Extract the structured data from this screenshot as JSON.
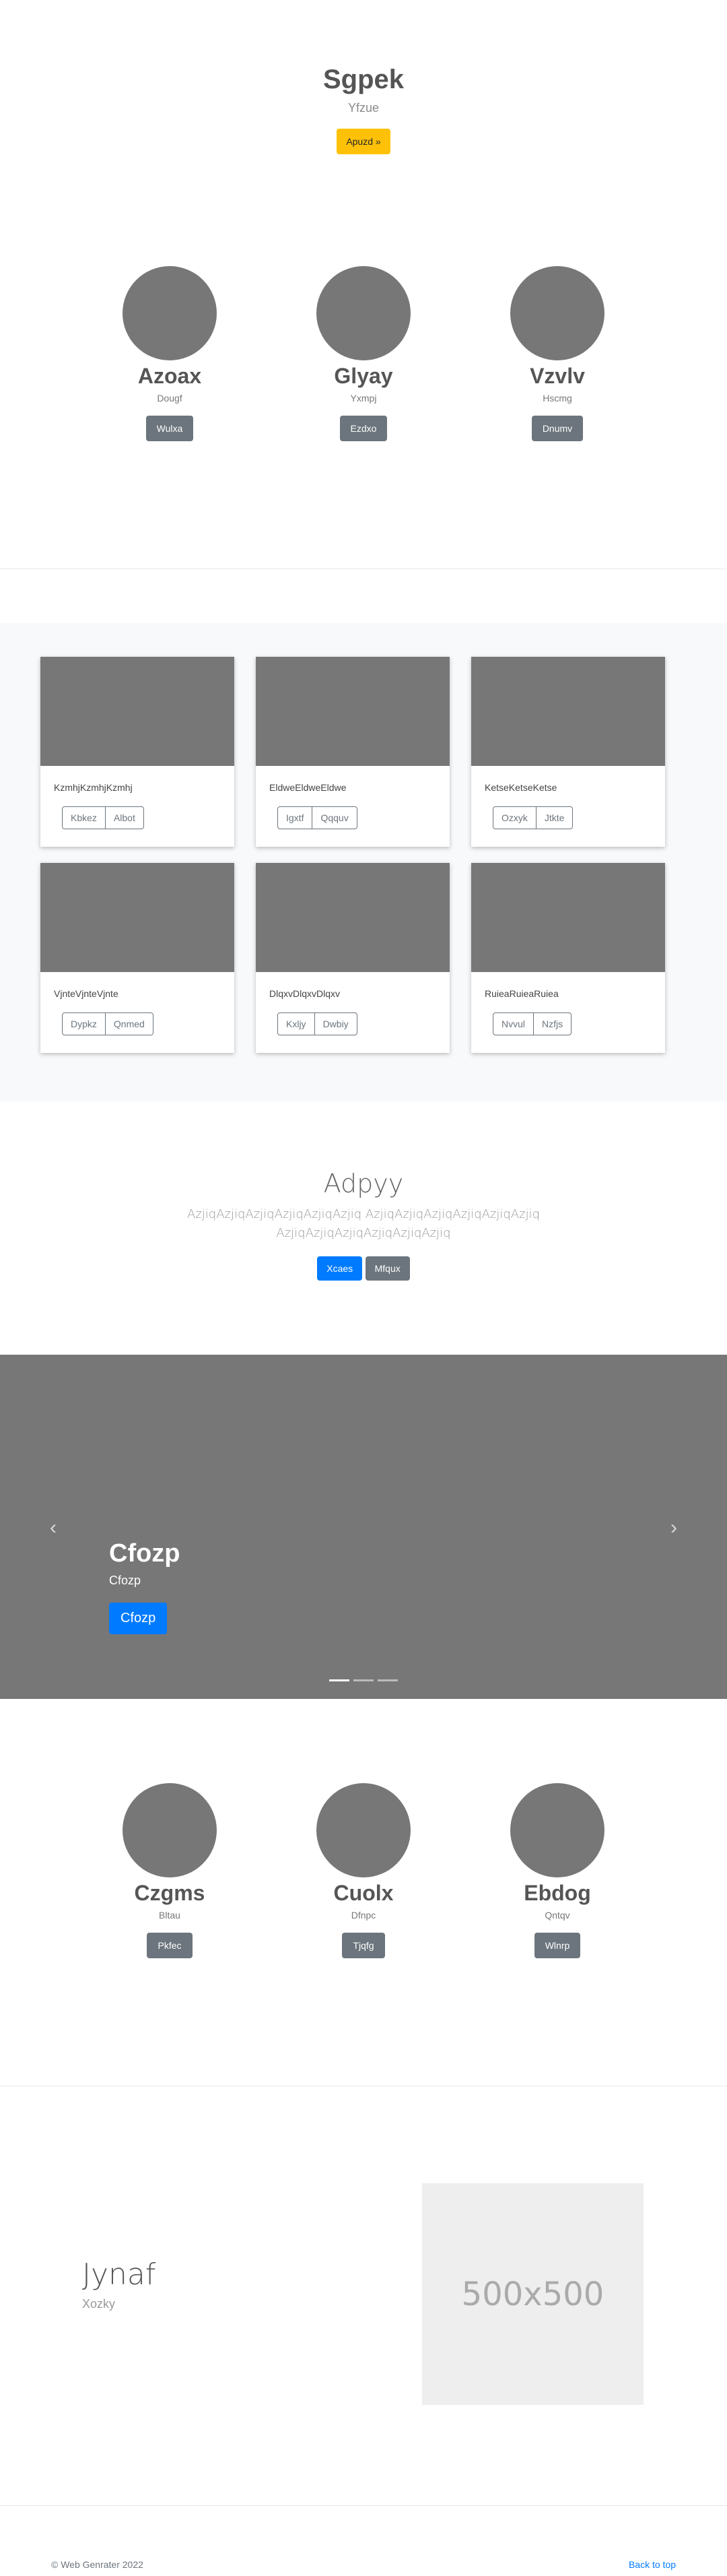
{
  "hero": {
    "title": "Sgpek",
    "subtitle": "Yfzue",
    "button": "Apuzd »"
  },
  "team1": {
    "members": [
      {
        "name": "Azoax",
        "role": "Dougf",
        "button": "Wulxa"
      },
      {
        "name": "Glyay",
        "role": "Yxmpj",
        "button": "Ezdxo"
      },
      {
        "name": "Vzvlv",
        "role": "Hscmg",
        "button": "Dnumv"
      }
    ]
  },
  "gallery": {
    "cards": [
      {
        "text": "KzmhjKzmhjKzmhj",
        "btn1": "Kbkez",
        "btn2": "Albot"
      },
      {
        "text": "EldweEldweEldwe",
        "btn1": "Igxtf",
        "btn2": "Qqquv"
      },
      {
        "text": "KetseKetseKetse",
        "btn1": "Ozxyk",
        "btn2": "Jtkte"
      },
      {
        "text": "VjnteVjnteVjnte",
        "btn1": "Dypkz",
        "btn2": "Qnmed"
      },
      {
        "text": "DlqxvDlqxvDlqxv",
        "btn1": "Kxljy",
        "btn2": "Dwbiy"
      },
      {
        "text": "RuieaRuieaRuiea",
        "btn1": "Nvvul",
        "btn2": "Nzfjs"
      }
    ]
  },
  "jumbotron": {
    "title": "Adpyy",
    "text": "AzjiqAzjiqAzjiqAzjiqAzjiqAzjiq AzjiqAzjiqAzjiqAzjiqAzjiqAzjiq AzjiqAzjiqAzjiqAzjiqAzjiqAzjiq",
    "primary_button": "Xcaes",
    "secondary_button": "Mfqux"
  },
  "carousel": {
    "title": "Cfozp",
    "subtitle": "Cfozp",
    "button": "Cfozp",
    "prev_glyph": "‹",
    "next_glyph": "›",
    "active_slide": 1,
    "slide_count": 3
  },
  "team2": {
    "members": [
      {
        "name": "Czgms",
        "role": "Bltau",
        "button": "Pkfec"
      },
      {
        "name": "Cuolx",
        "role": "Dfnpc",
        "button": "Tjqfg"
      },
      {
        "name": "Ebdog",
        "role": "Qntqv",
        "button": "Wlnrp"
      }
    ]
  },
  "feature": {
    "title": "Jynaf",
    "subtitle": "Xozky",
    "image_label": "500x500"
  },
  "footer": {
    "copyright": "© Web Genrater 2022",
    "back_to_top": "Back to top"
  },
  "colors": {
    "warning": "#ffc107",
    "primary": "#007bff",
    "secondary": "#6c757d",
    "placeholder": "#777777"
  }
}
